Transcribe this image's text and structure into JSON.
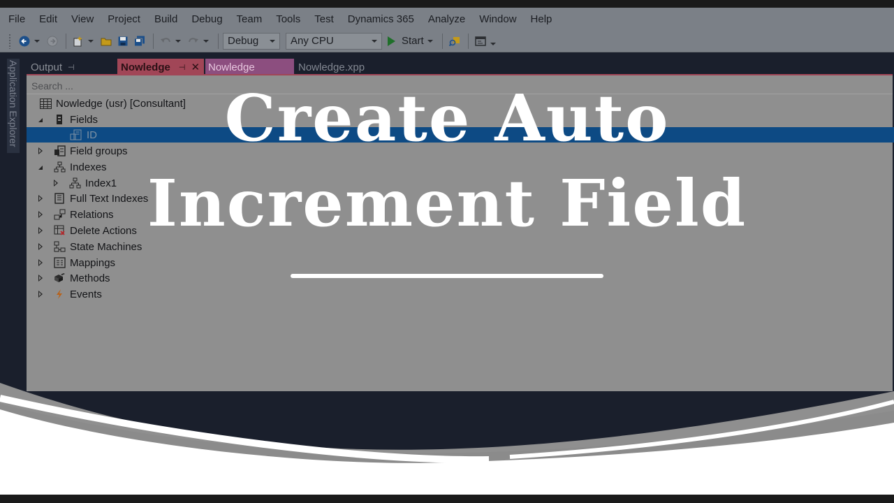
{
  "menu": [
    "File",
    "Edit",
    "View",
    "Project",
    "Build",
    "Debug",
    "Team",
    "Tools",
    "Test",
    "Dynamics 365",
    "Analyze",
    "Window",
    "Help"
  ],
  "toolbar": {
    "configuration": "Debug",
    "platform": "Any CPU",
    "start_label": "Start"
  },
  "side_panel": {
    "label": "Application Explorer"
  },
  "tabs": {
    "output": "Output",
    "active": "Nowledge",
    "preview": "Nowledge",
    "file": "Nowledge.xpp"
  },
  "explorer": {
    "search_placeholder": "Search ...",
    "root": "Nowledge (usr) [Consultant]",
    "items": [
      {
        "label": "Fields",
        "icon": "field-icon"
      },
      {
        "label": "ID",
        "icon": "integer-field-icon"
      },
      {
        "label": "Field groups",
        "icon": "field-group-icon"
      },
      {
        "label": "Indexes",
        "icon": "index-icon"
      },
      {
        "label": "Index1",
        "icon": "index-icon"
      },
      {
        "label": "Full Text Indexes",
        "icon": "full-text-index-icon"
      },
      {
        "label": "Relations",
        "icon": "relations-icon"
      },
      {
        "label": "Delete Actions",
        "icon": "delete-actions-icon"
      },
      {
        "label": "State Machines",
        "icon": "state-machine-icon"
      },
      {
        "label": "Mappings",
        "icon": "mappings-icon"
      },
      {
        "label": "Methods",
        "icon": "methods-icon"
      },
      {
        "label": "Events",
        "icon": "events-icon"
      }
    ]
  },
  "overlay": {
    "title_line1": "Create Auto",
    "title_line2": "Increment Field"
  },
  "colors": {
    "chrome": "#7b8087",
    "frame": "#1a1f2c",
    "panel": "#8f8f8f",
    "active_tab": "#a14657",
    "preview_tab": "#8c4e7f",
    "selection": "#0d4a84"
  }
}
